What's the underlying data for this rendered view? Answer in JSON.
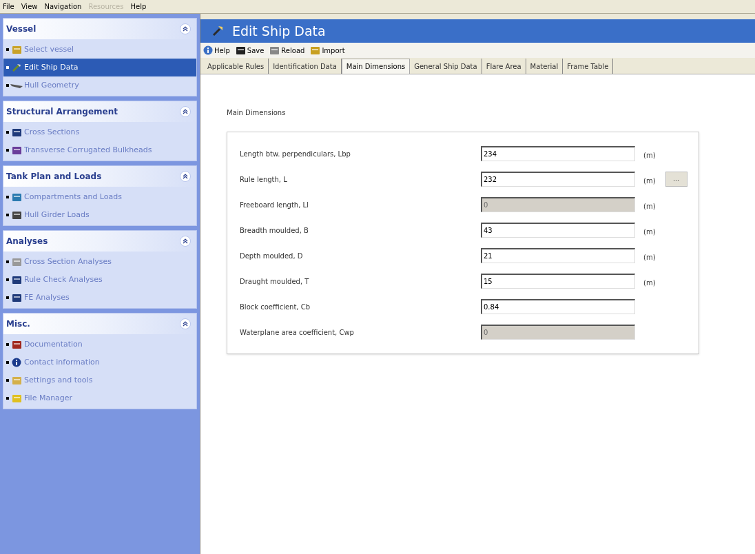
{
  "menu": [
    {
      "label": "File",
      "disabled": false
    },
    {
      "label": "View",
      "disabled": false
    },
    {
      "label": "Navigation",
      "disabled": false
    },
    {
      "label": "Resources",
      "disabled": true
    },
    {
      "label": "Help",
      "disabled": false
    }
  ],
  "sidebar": {
    "sections": [
      {
        "title": "Vessel",
        "items": [
          {
            "label": "Select vessel",
            "selected": false
          },
          {
            "label": "Edit Ship Data",
            "selected": true
          },
          {
            "label": "Hull Geometry",
            "selected": false
          }
        ]
      },
      {
        "title": "Structural Arrangement",
        "items": [
          {
            "label": "Cross Sections",
            "selected": false
          },
          {
            "label": "Transverse Corrugated Bulkheads",
            "selected": false
          }
        ]
      },
      {
        "title": "Tank Plan and Loads",
        "items": [
          {
            "label": "Compartments and Loads",
            "selected": false
          },
          {
            "label": "Hull Girder Loads",
            "selected": false
          }
        ]
      },
      {
        "title": "Analyses",
        "items": [
          {
            "label": "Cross Section Analyses",
            "selected": false
          },
          {
            "label": "Rule Check Analyses",
            "selected": false
          },
          {
            "label": "FE Analyses",
            "selected": false
          }
        ]
      },
      {
        "title": "Misc.",
        "items": [
          {
            "label": "Documentation",
            "selected": false
          },
          {
            "label": "Contact information",
            "selected": false
          },
          {
            "label": "Settings and tools",
            "selected": false
          },
          {
            "label": "File Manager",
            "selected": false
          }
        ]
      }
    ]
  },
  "page": {
    "title": "Edit Ship Data",
    "toolbar": [
      {
        "label": "Help"
      },
      {
        "label": "Save"
      },
      {
        "label": "Reload"
      },
      {
        "label": "Import"
      }
    ],
    "tabs": [
      {
        "label": "Applicable Rules",
        "selected": false
      },
      {
        "label": "Identification Data",
        "selected": false
      },
      {
        "label": "Main Dimensions",
        "selected": true
      },
      {
        "label": "General Ship Data",
        "selected": false
      },
      {
        "label": "Flare Area",
        "selected": false
      },
      {
        "label": "Material",
        "selected": false
      },
      {
        "label": "Frame Table",
        "selected": false
      }
    ],
    "group_title": "Main Dimensions",
    "fields": [
      {
        "label": "Length btw. perpendiculars, Lbp",
        "value": "234",
        "disabled": false,
        "unit": "(m)"
      },
      {
        "label": "Rule length, L",
        "value": "232",
        "disabled": false,
        "unit": "(m)",
        "button": "..."
      },
      {
        "label": "Freeboard length, Ll",
        "value": "0",
        "disabled": true,
        "unit": "(m)"
      },
      {
        "label": "Breadth moulded, B",
        "value": "43",
        "disabled": false,
        "unit": "(m)"
      },
      {
        "label": "Depth moulded, D",
        "value": "21",
        "disabled": false,
        "unit": "(m)"
      },
      {
        "label": "Draught moulded, T",
        "value": "15",
        "disabled": false,
        "unit": "(m)"
      },
      {
        "label": "Block coefficient, Cb",
        "value": "0.84",
        "disabled": false
      },
      {
        "label": "Waterplane area coefficient, Cwp",
        "value": "0",
        "disabled": true
      }
    ]
  }
}
